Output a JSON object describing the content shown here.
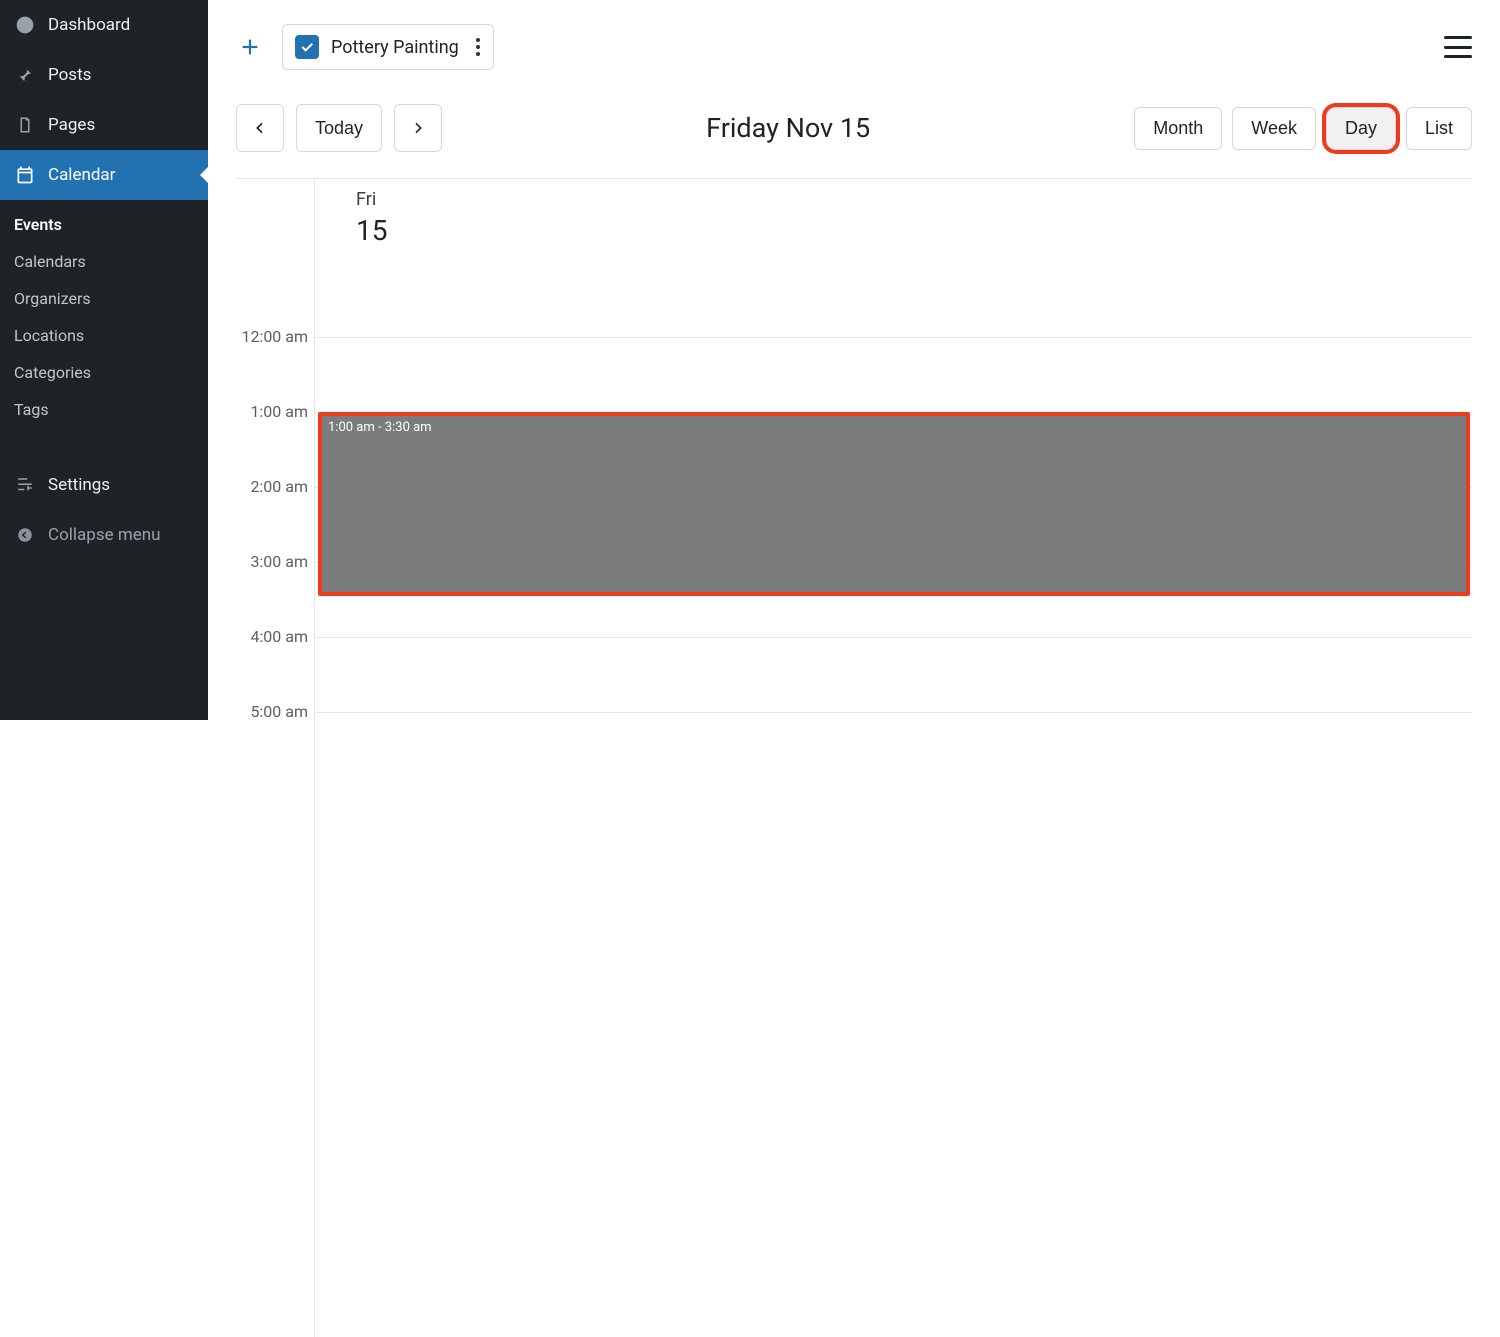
{
  "sidebar": {
    "items": [
      {
        "label": "Dashboard"
      },
      {
        "label": "Posts"
      },
      {
        "label": "Pages"
      },
      {
        "label": "Calendar"
      }
    ],
    "sub_items": [
      {
        "label": "Events"
      },
      {
        "label": "Calendars"
      },
      {
        "label": "Organizers"
      },
      {
        "label": "Locations"
      },
      {
        "label": "Categories"
      },
      {
        "label": "Tags"
      }
    ],
    "settings_label": "Settings",
    "collapse_label": "Collapse menu"
  },
  "toolbar": {
    "filter_label": "Pottery Painting"
  },
  "nav": {
    "today_label": "Today",
    "title": "Friday Nov 15",
    "views": {
      "month": "Month",
      "week": "Week",
      "day": "Day",
      "list": "List"
    }
  },
  "day": {
    "dow": "Fri",
    "num": "15",
    "hours": [
      "12:00 am",
      "1:00 am",
      "2:00 am",
      "3:00 am",
      "4:00 am",
      "5:00 am"
    ]
  },
  "selection": {
    "label": "1:00 am - 3:30 am",
    "start_hour_index": 1,
    "end_hour_index": 3.5
  }
}
